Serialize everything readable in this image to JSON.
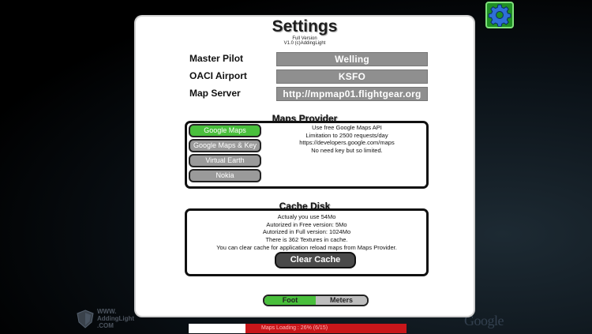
{
  "settings": {
    "title": "Settings",
    "version_line1": "Full Version",
    "version_line2": "V1.0 (c)AddingLight",
    "fields": [
      {
        "label": "Master Pilot",
        "value": "Welling"
      },
      {
        "label": "OACI Airport",
        "value": "KSFO"
      },
      {
        "label": "Map Server",
        "value": "http://mpmap01.flightgear.org"
      }
    ],
    "maps_provider": {
      "title": "Maps Provider",
      "options": [
        "Google Maps",
        "Google Maps & Key",
        "Virtual Earth",
        "Nokia"
      ],
      "selected": "Google Maps",
      "description": [
        "Use free Google Maps API",
        "Limitation to 2500 requests/day",
        "https://developers.google.com/maps",
        "No need key but so limited."
      ]
    },
    "cache_disk": {
      "title": "Cache Disk",
      "lines": [
        "Actualy you use 54Mo",
        "Autorized in Free version: 5Mo",
        "Autorized in Full version: 1024Mo",
        "There is 362 Textures in cache."
      ],
      "note": "You can clear cache for application reload maps from Maps Provider.",
      "clear_label": "Clear Cache"
    },
    "units": {
      "options": [
        "Foot",
        "Meters"
      ],
      "selected": "Foot"
    }
  },
  "loading": {
    "text": "Maps Loading : 26% (6/15)",
    "progress": 0.26
  },
  "watermark": {
    "brand_lines": [
      "WWW.",
      "AddingLight",
      ".COM"
    ],
    "map_brand": "Google"
  },
  "icons": {
    "settings": "gear-icon",
    "brand": "shield-icon"
  },
  "colors": {
    "active": "#49bf3c",
    "field_bg": "#8f8f8f",
    "loading_bar": "#c8161a",
    "gear_bg": "#1f8f24"
  }
}
